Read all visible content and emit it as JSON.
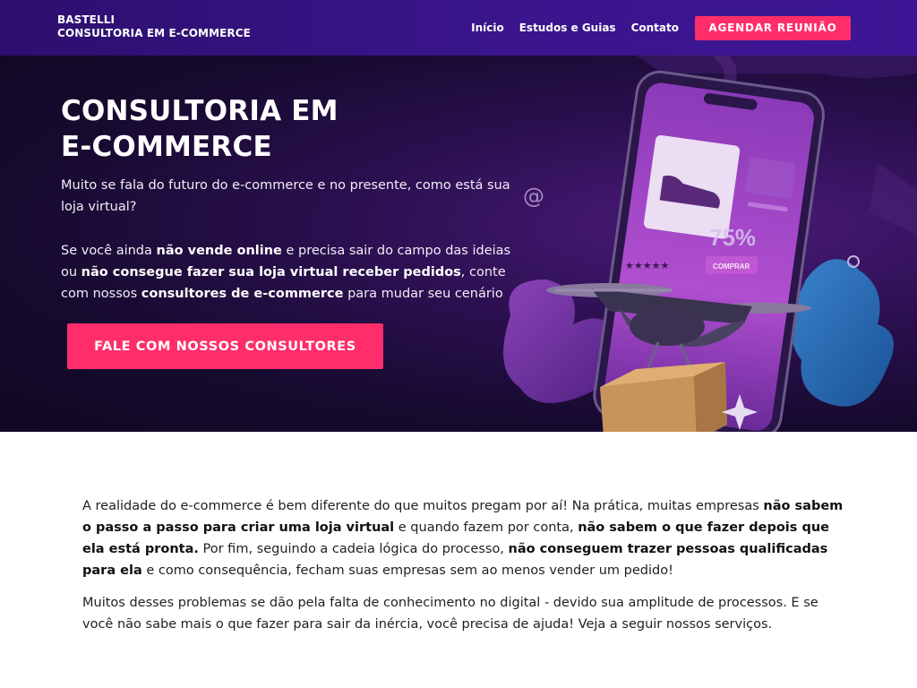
{
  "header": {
    "brand_line1": "BASTELLI",
    "brand_line2": "CONSULTORIA EM E-COMMERCE",
    "nav": [
      "Início",
      "Estudos e Guias",
      "Contato"
    ],
    "cta": "AGENDAR REUNIÃO",
    "accent": "#ff2e6a",
    "background": "#3a158c"
  },
  "hero": {
    "title_line1": "CONSULTORIA EM",
    "title_line2": "E-COMMERCE",
    "p1": "Muito se fala do futuro do e-commerce e no presente, como está sua loja virtual?",
    "p2": {
      "a": "Se você ainda ",
      "b": "não vende online",
      "c": " e precisa sair do campo das ideias ou ",
      "d": "não consegue fazer sua loja virtual receber pedidos",
      "e": ", conte com nossos ",
      "f": "consultores de e-commerce",
      "g": " para mudar seu cenário"
    },
    "cta": "FALE COM NOSSOS CONSULTORES",
    "illustration": {
      "discount": "75%",
      "buy_button": "COMPRAR",
      "at_symbol": "@"
    }
  },
  "content": {
    "p1": {
      "a": "A realidade do e-commerce é bem diferente do que muitos pregam por aí! Na prática, muitas empresas ",
      "b": "não sabem o passo a passo para criar uma loja virtual",
      "c": " e quando fazem por conta, ",
      "d": "não sabem o que fazer depois que ela está pronta.",
      "e": " Por fim, seguindo a cadeia lógica do processo, ",
      "f": "não conseguem trazer pessoas qualificadas para ela",
      "g": " e como consequência, fecham suas empresas sem ao menos vender um pedido!"
    },
    "p2": "Muitos desses problemas se dão pela falta de conhecimento no digital - devido sua amplitude de processos. E se você não sabe mais o que fazer para sair da inércia, você precisa de ajuda! Veja a seguir nossos serviços."
  }
}
